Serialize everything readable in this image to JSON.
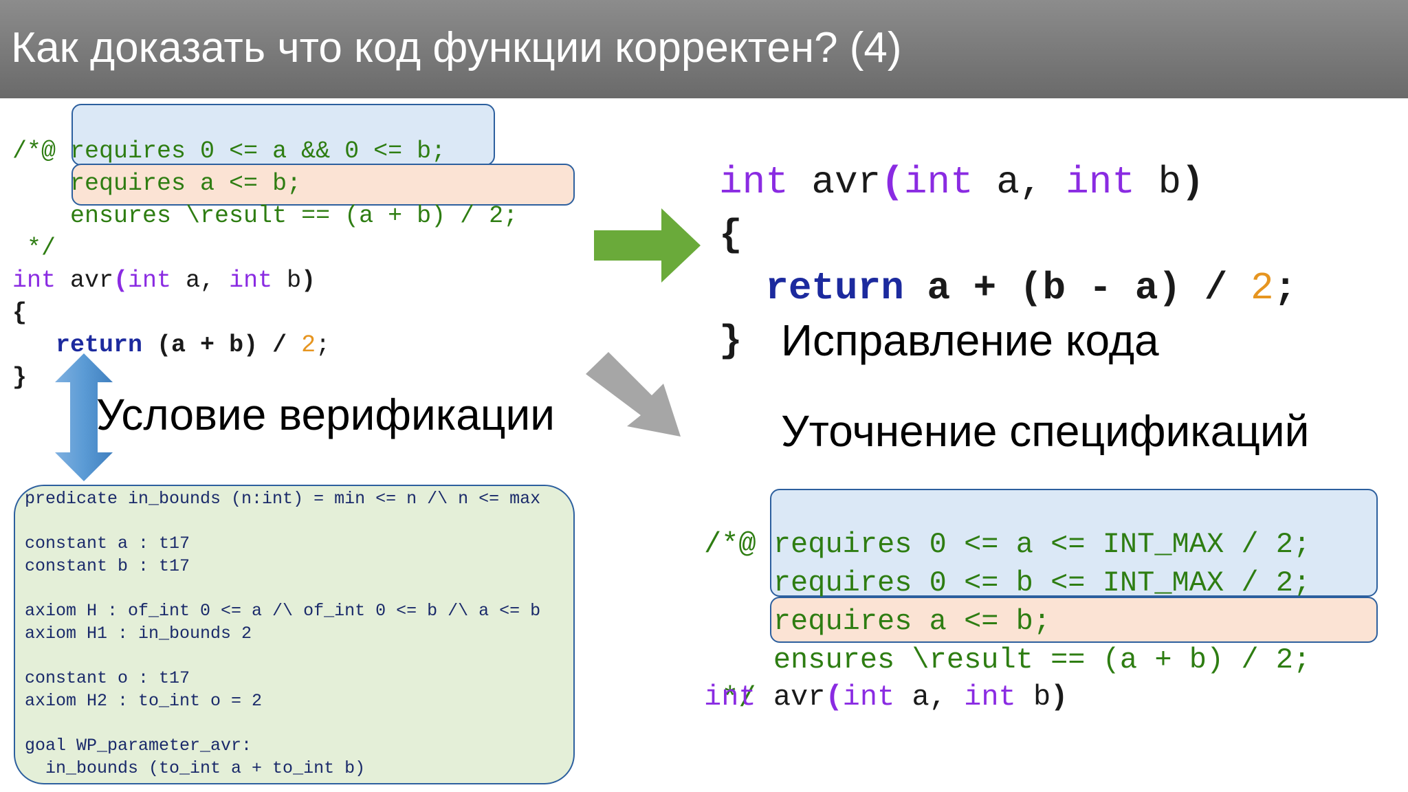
{
  "slide": {
    "title": "Как доказать что код функции корректен? (4)"
  },
  "left_code": {
    "comment_open": "/*@",
    "req1": "requires 0 <= a && 0 <= b;",
    "req2": "requires a <= b;",
    "ens": "ensures \\result == (a + b) / 2;",
    "comment_close": "*/",
    "sig_int1": "int",
    "sig_name": " avr",
    "sig_paren": "(",
    "sig_int2": "int",
    "sig_a": " a, ",
    "sig_int3": "int",
    "sig_b": " b",
    "sig_close": ")",
    "brace_open": "{",
    "ret_kw": "return",
    "ret_expr": " (a + b) / ",
    "ret_num": "2",
    "ret_semi": ";",
    "brace_close": "}"
  },
  "right_code": {
    "sig_int1": "int",
    "sig_name": " avr",
    "sig_paren": "(",
    "sig_int2": "int",
    "sig_a": " a, ",
    "sig_int3": "int",
    "sig_b": " b",
    "sig_close": ")",
    "brace_open": "{",
    "ret_kw": "return",
    "ret_expr": " a + (b - a) / ",
    "ret_num": "2",
    "ret_semi": ";",
    "brace_close": "}"
  },
  "labels": {
    "fix_code": "Исправление кода",
    "refine_spec": "Уточнение спецификаций",
    "vc": "Условие верификации"
  },
  "right_spec": {
    "comment_open": "/*@",
    "req1": "requires 0 <= a <= INT_MAX / 2;",
    "req2": "requires 0 <= b <= INT_MAX / 2;",
    "req3": "requires a <= b;",
    "ens": "ensures \\result == (a + b) / 2;",
    "comment_close": "*/",
    "sig_int1": "int",
    "sig_name": " avr",
    "sig_paren": "(",
    "sig_int2": "int",
    "sig_a": " a, ",
    "sig_int3": "int",
    "sig_b": " b",
    "sig_close": ")"
  },
  "vc_text": {
    "l1": "predicate in_bounds (n:int) = min <= n /\\ n <= max",
    "l2": "constant a : t17",
    "l3": "constant b : t17",
    "l4": "axiom H : of_int 0 <= a /\\ of_int 0 <= b /\\ a <= b",
    "l5": "axiom H1 : in_bounds 2",
    "l6": "constant o : t17",
    "l7": "axiom H2 : to_int o = 2",
    "l8": "goal WP_parameter_avr:",
    "l9": "  in_bounds (to_int a + to_int b)"
  },
  "colors": {
    "header": "#7a7a7a",
    "spec_green": "#2e7d12",
    "keyword_purple": "#8a2be2",
    "return_blue": "#1c2a9e",
    "number_orange": "#e69520",
    "requires_box": "#dbe8f6",
    "ensures_box": "#fbe3d4",
    "vc_box": "#e4efd8",
    "arrow_green": "#6aaa3a",
    "arrow_gray": "#a6a6a6",
    "arrow_blue": "#5b9bd5"
  }
}
